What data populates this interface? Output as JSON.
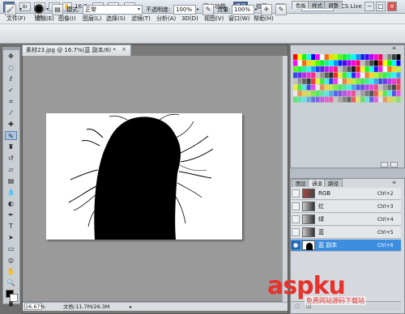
{
  "app": {
    "logo": "Ps",
    "zoom_value": "16.7",
    "workspaces": [
      "基本功能",
      "设计",
      "绘画",
      "摄影"
    ],
    "active_workspace": "设计",
    "cs_live": "CS Live"
  },
  "menu": [
    "文件(F)",
    "编辑(E)",
    "图像(I)",
    "图层(L)",
    "选择(S)",
    "滤镜(T)",
    "分析(A)",
    "3D(D)",
    "视图(V)",
    "窗口(W)",
    "帮助(H)"
  ],
  "options": {
    "brush_size": "160",
    "mode_label": "模式:",
    "mode_value": "正常",
    "opacity_label": "不透明度:",
    "opacity_value": "100%",
    "flow_label": "流量:",
    "flow_value": "100%"
  },
  "document": {
    "tab_title": "素材23.jpg @ 16.7%(蓝 副本/8) *",
    "zoom_status": "16.67%",
    "doc_info": "文档:11.7M/26.3M"
  },
  "color_panel": {
    "tabs": [
      "色板",
      "样式",
      "调整"
    ],
    "swatch_colors": [
      "#ff0000",
      "#ffff00",
      "#00ff00",
      "#00ffff",
      "#0000ff",
      "#ff00ff",
      "#ffffff",
      "#ff6a00",
      "#ffd800",
      "#b6ff00",
      "#4cff00",
      "#00ff21",
      "#00ff90",
      "#00ffff",
      "#0094ff",
      "#0026ff",
      "#4800ff",
      "#b200ff",
      "#ff00dc",
      "#ff006e",
      "#c0c0c0",
      "#808080",
      "#404040",
      "#000000"
    ]
  },
  "channels_panel": {
    "tabs": [
      "图层",
      "通道",
      "路径"
    ],
    "rows": [
      {
        "name": "RGB",
        "key": "Ctrl+2",
        "selected": false
      },
      {
        "name": "红",
        "key": "Ctrl+3",
        "selected": false
      },
      {
        "name": "绿",
        "key": "Ctrl+4",
        "selected": false
      },
      {
        "name": "蓝",
        "key": "Ctrl+5",
        "selected": false
      },
      {
        "name": "蓝 副本",
        "key": "Ctrl+6",
        "selected": true
      }
    ]
  },
  "watermark": {
    "text": "aspku",
    "sub": "免费网站源码下载站"
  }
}
